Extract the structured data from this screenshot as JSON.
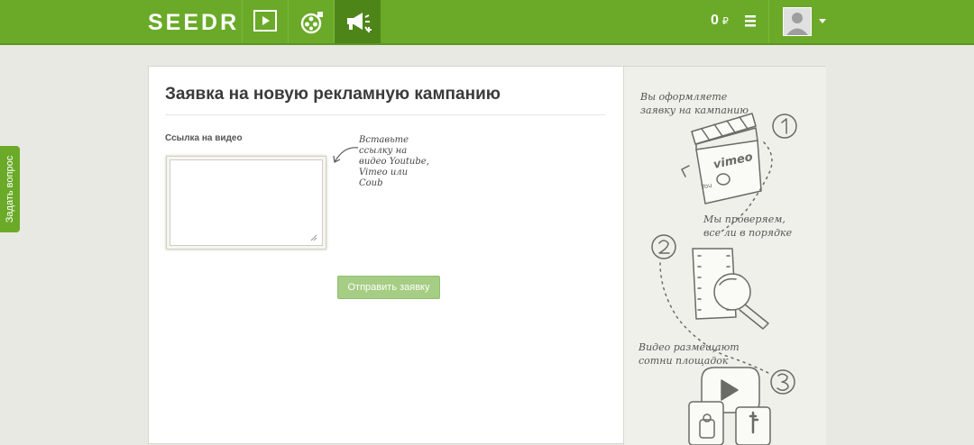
{
  "header": {
    "logo": "SEEDR",
    "nav": [
      {
        "name": "video",
        "icon": "play-icon"
      },
      {
        "name": "film",
        "icon": "film-reel-icon"
      },
      {
        "name": "campaign",
        "icon": "megaphone-icon",
        "active": true
      }
    ],
    "balance_amount": "0",
    "balance_currency": "₽",
    "menu_icon": "hamburger-icon",
    "user_icon": "user-avatar-icon",
    "accent_color": "#6aaa28"
  },
  "side_tab": {
    "label": "Задать вопрос"
  },
  "form": {
    "title": "Заявка на новую рекламную кампанию",
    "field_label": "Ссылка на видео",
    "field_value": "",
    "hint_lines": [
      "Вставьте",
      "ссылку на",
      "видео Youtube,",
      "Vimeo или",
      "Coub"
    ],
    "submit_label": "Отправить заявку"
  },
  "steps": [
    {
      "number": "1",
      "lines": [
        "Вы оформляете",
        "заявку на кампанию"
      ],
      "illustration_text": "vimeo"
    },
    {
      "number": "2",
      "lines": [
        "Мы проверяем,",
        "все ли в порядке"
      ]
    },
    {
      "number": "3",
      "lines": [
        "Видео размещают",
        "сотни площадок"
      ]
    }
  ]
}
